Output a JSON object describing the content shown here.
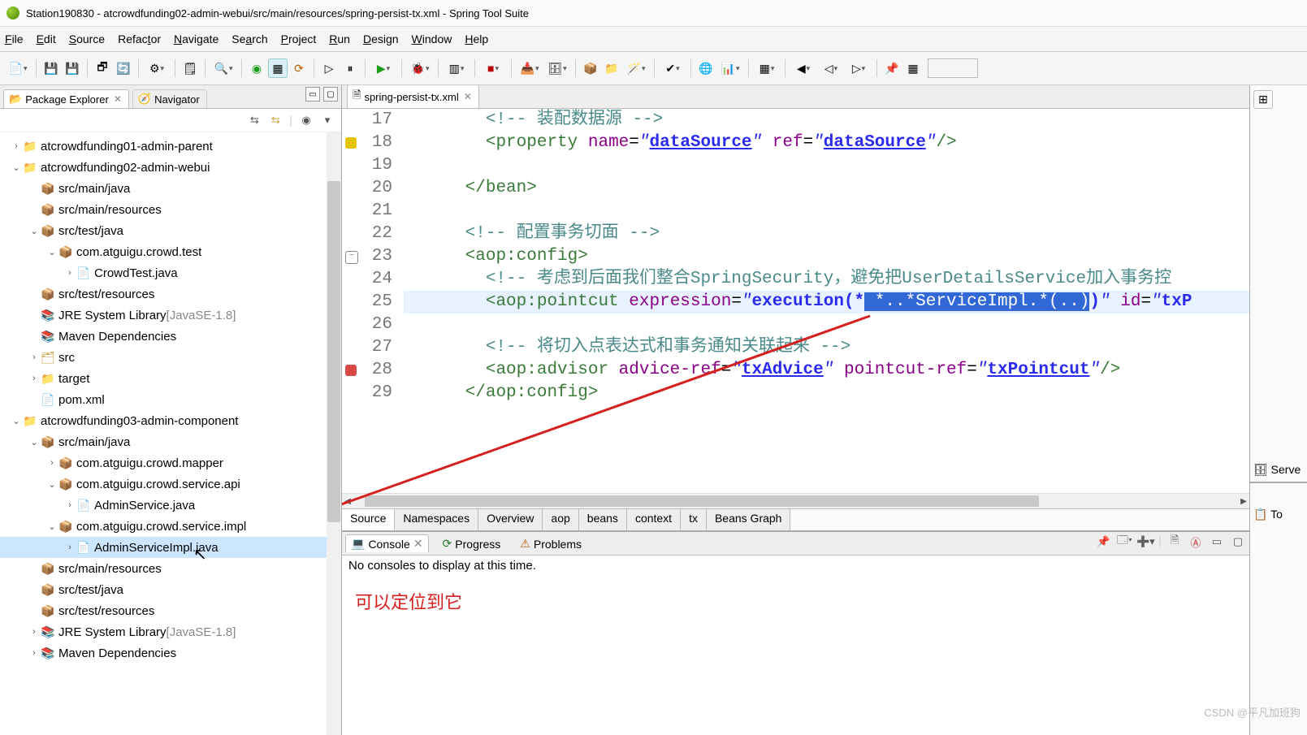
{
  "title": "Station190830 - atcrowdfunding02-admin-webui/src/main/resources/spring-persist-tx.xml - Spring Tool Suite",
  "menu": {
    "file": "File",
    "edit": "Edit",
    "source": "Source",
    "refactor": "Refactor",
    "navigate": "Navigate",
    "search": "Search",
    "project": "Project",
    "run": "Run",
    "design": "Design",
    "window": "Window",
    "help": "Help"
  },
  "left": {
    "tab_active": "Package Explorer",
    "tab_inactive": "Navigator"
  },
  "tree": [
    {
      "d": 0,
      "tw": ">",
      "ic": "📁",
      "cls": "ic-proj",
      "label": "atcrowdfunding01-admin-parent"
    },
    {
      "d": 0,
      "tw": "v",
      "ic": "📁",
      "cls": "ic-proj",
      "label": "atcrowdfunding02-admin-webui"
    },
    {
      "d": 1,
      "tw": "",
      "ic": "📦",
      "cls": "ic-folder",
      "label": "src/main/java"
    },
    {
      "d": 1,
      "tw": "",
      "ic": "📦",
      "cls": "ic-folder",
      "label": "src/main/resources"
    },
    {
      "d": 1,
      "tw": "v",
      "ic": "📦",
      "cls": "ic-folder",
      "label": "src/test/java"
    },
    {
      "d": 2,
      "tw": "v",
      "ic": "📦",
      "cls": "ic-pkg",
      "label": "com.atguigu.crowd.test"
    },
    {
      "d": 3,
      "tw": ">",
      "ic": "📄",
      "cls": "ic-java",
      "label": "CrowdTest.java"
    },
    {
      "d": 1,
      "tw": "",
      "ic": "📦",
      "cls": "ic-folder",
      "label": "src/test/resources"
    },
    {
      "d": 1,
      "tw": "",
      "ic": "📚",
      "cls": "ic-jre",
      "label": "JRE System Library ",
      "suffix": "[JavaSE-1.8]"
    },
    {
      "d": 1,
      "tw": "",
      "ic": "📚",
      "cls": "ic-jre",
      "label": "Maven Dependencies"
    },
    {
      "d": 1,
      "tw": ">",
      "ic": "🗂",
      "cls": "ic-folder",
      "label": "src"
    },
    {
      "d": 1,
      "tw": ">",
      "ic": "📁",
      "cls": "ic-folder",
      "label": "target"
    },
    {
      "d": 1,
      "tw": "",
      "ic": "📄",
      "cls": "ic-xml",
      "label": "pom.xml"
    },
    {
      "d": 0,
      "tw": "v",
      "ic": "📁",
      "cls": "ic-proj",
      "label": "atcrowdfunding03-admin-component"
    },
    {
      "d": 1,
      "tw": "v",
      "ic": "📦",
      "cls": "ic-folder",
      "label": "src/main/java"
    },
    {
      "d": 2,
      "tw": ">",
      "ic": "📦",
      "cls": "ic-pkg",
      "label": "com.atguigu.crowd.mapper"
    },
    {
      "d": 2,
      "tw": "v",
      "ic": "📦",
      "cls": "ic-pkg",
      "label": "com.atguigu.crowd.service.api"
    },
    {
      "d": 3,
      "tw": ">",
      "ic": "📄",
      "cls": "ic-java",
      "label": "AdminService.java"
    },
    {
      "d": 2,
      "tw": "v",
      "ic": "📦",
      "cls": "ic-pkg",
      "label": "com.atguigu.crowd.service.impl"
    },
    {
      "d": 3,
      "tw": ">",
      "ic": "📄",
      "cls": "ic-java",
      "label": "AdminServiceImpl.java",
      "sel": true
    },
    {
      "d": 1,
      "tw": "",
      "ic": "📦",
      "cls": "ic-folder",
      "label": "src/main/resources"
    },
    {
      "d": 1,
      "tw": "",
      "ic": "📦",
      "cls": "ic-folder",
      "label": "src/test/java"
    },
    {
      "d": 1,
      "tw": "",
      "ic": "📦",
      "cls": "ic-folder",
      "label": "src/test/resources"
    },
    {
      "d": 1,
      "tw": ">",
      "ic": "📚",
      "cls": "ic-jre",
      "label": "JRE System Library ",
      "suffix": "[JavaSE-1.8]"
    },
    {
      "d": 1,
      "tw": ">",
      "ic": "📚",
      "cls": "ic-jre",
      "label": "Maven Dependencies"
    }
  ],
  "editor": {
    "tab": "spring-persist-tx.xml",
    "lines": {
      "start": 17,
      "markers": {
        "18": "warn",
        "23": "fold",
        "28": "err"
      },
      "highlight": 25,
      "html": [
        "        <span class='c-comment'>&lt;!-- 装配数据源 --&gt;</span>",
        "        <span class='c-bk'>&lt;</span><span class='c-tag'>property</span> <span class='c-attr'>name</span>=<span class='c-val'>\"</span><span class='c-ref'>dataSource</span><span class='c-val'>\"</span> <span class='c-attr'>ref</span>=<span class='c-val'>\"</span><span class='c-ref'>dataSource</span><span class='c-val'>\"</span><span class='c-bk'>/&gt;</span>",
        "",
        "      <span class='c-bk'>&lt;/</span><span class='c-tag'>bean</span><span class='c-bk'>&gt;</span>",
        "",
        "      <span class='c-comment'>&lt;!-- 配置事务切面 --&gt;</span>",
        "      <span class='c-bk'>&lt;</span><span class='c-tag'>aop:config</span><span class='c-bk'>&gt;</span>",
        "        <span class='c-comment'>&lt;!-- 考虑到后面我们整合SpringSecurity，避免把UserDetailsService加入事务控</span>",
        "        <span class='c-bk'>&lt;</span><span class='c-tag'>aop:pointcut</span> <span class='c-attr'>expression</span>=<span class='c-val'>\"</span><span class='c-val-b'>execution(*</span><span class='sel'> *..*ServiceImpl.*(..)</span><span class='c-val-b'>)</span><span class='c-val'>\"</span> <span class='c-attr'>id</span>=<span class='c-val'>\"</span><span class='c-val-b'>txP</span>",
        "",
        "        <span class='c-comment'>&lt;!-- 将切入点表达式和事务通知关联起来 --&gt;</span>",
        "        <span class='c-bk'>&lt;</span><span class='c-tag'>aop:advisor</span> <span class='c-attr'>advice-ref</span>=<span class='c-val'>\"</span><span class='c-ref'>txAdvice</span><span class='c-val'>\"</span> <span class='c-attr'>pointcut-ref</span>=<span class='c-val'>\"</span><span class='c-ref'>txPointcut</span><span class='c-val'>\"</span><span class='c-bk'>/&gt;</span>",
        "      <span class='c-bk'>&lt;/</span><span class='c-tag'>aop:config</span><span class='c-bk'>&gt;</span>"
      ]
    },
    "bottom_tabs": [
      "Source",
      "Namespaces",
      "Overview",
      "aop",
      "beans",
      "context",
      "tx",
      "Beans Graph"
    ],
    "bottom_active": 0
  },
  "console": {
    "tabs": [
      "Console",
      "Progress",
      "Problems"
    ],
    "active": 0,
    "message": "No consoles to display at this time."
  },
  "right": {
    "servers": "Serve",
    "to": "To"
  },
  "annotation": {
    "text": "可以定位到它"
  },
  "watermark": "CSDN @平凡加班狗"
}
